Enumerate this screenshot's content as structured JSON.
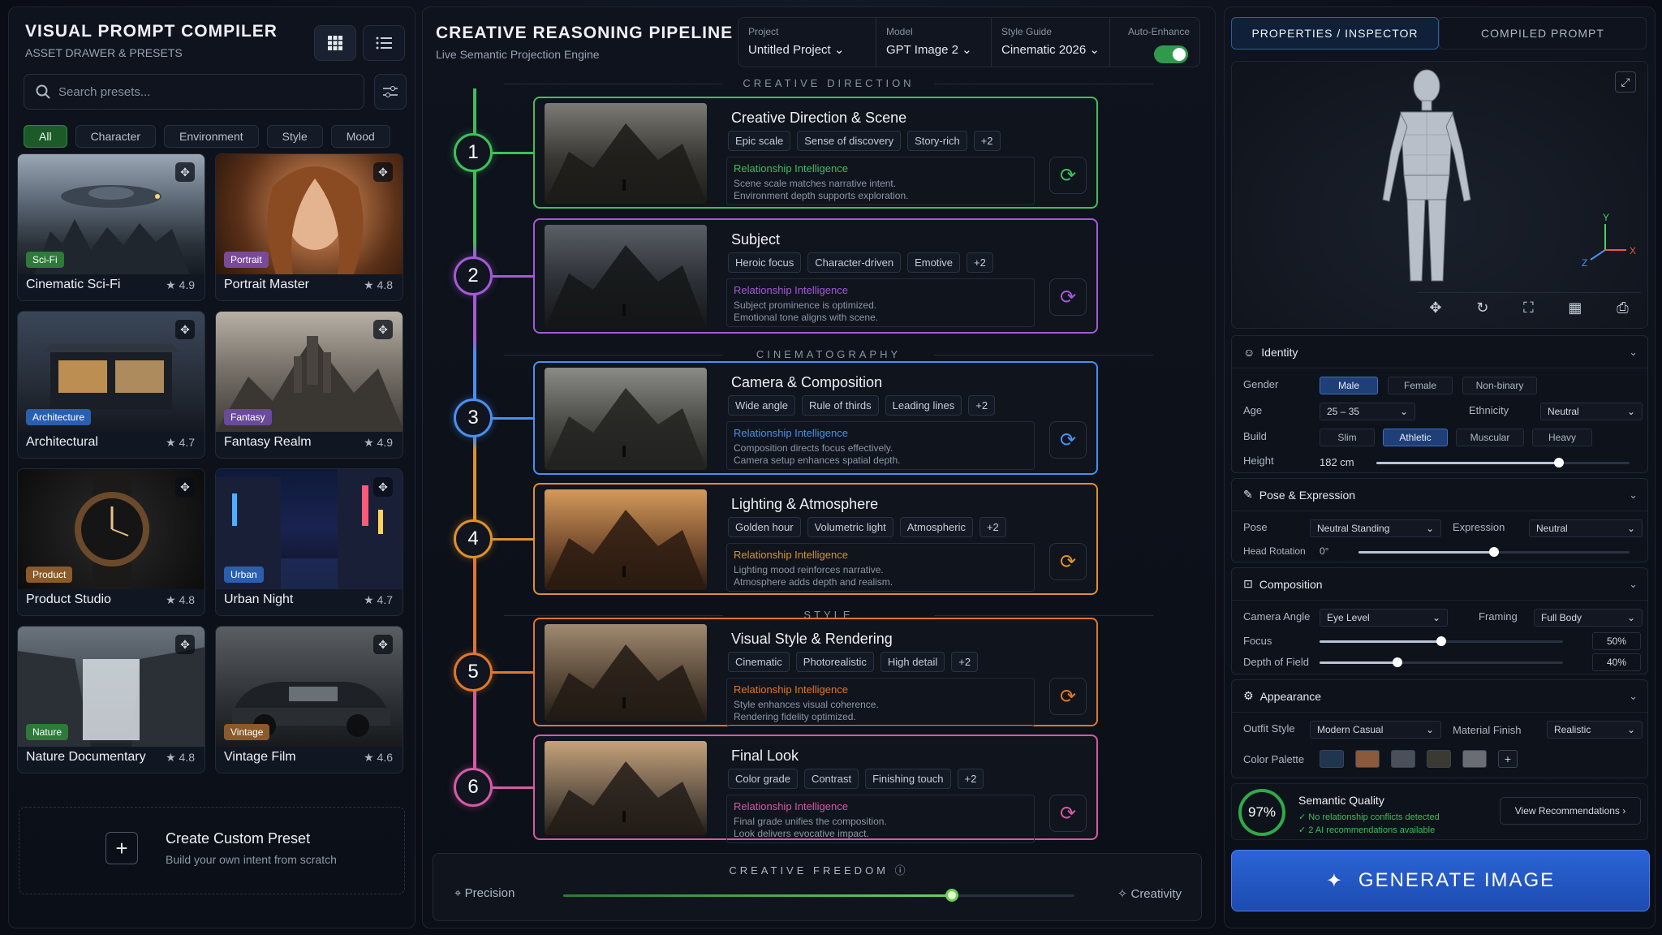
{
  "left": {
    "title": "VISUAL PROMPT COMPILER",
    "subtitle": "ASSET DRAWER & PRESETS",
    "search_placeholder": "Search presets...",
    "filters": [
      "All",
      "Character",
      "Environment",
      "Style",
      "Mood"
    ],
    "presets": [
      {
        "name": "Cinematic Sci-Fi",
        "tag": "Sci-Fi",
        "rating": "4.9",
        "tag_color": "#2d7a3a"
      },
      {
        "name": "Portrait Master",
        "tag": "Portrait",
        "rating": "4.8",
        "tag_color": "#7a4a9a"
      },
      {
        "name": "Architectural",
        "tag": "Architecture",
        "rating": "4.7",
        "tag_color": "#2a5fb0"
      },
      {
        "name": "Fantasy Realm",
        "tag": "Fantasy",
        "rating": "4.9",
        "tag_color": "#6a4a9a"
      },
      {
        "name": "Product Studio",
        "tag": "Product",
        "rating": "4.8",
        "tag_color": "#8a5a2a"
      },
      {
        "name": "Urban Night",
        "tag": "Urban",
        "rating": "4.7",
        "tag_color": "#2a5fb0"
      },
      {
        "name": "Nature Documentary",
        "tag": "Nature",
        "rating": "4.8",
        "tag_color": "#2d7a3a"
      },
      {
        "name": "Vintage Film",
        "tag": "Vintage",
        "rating": "4.6",
        "tag_color": "#8a5a2a"
      }
    ],
    "create_title": "Create Custom Preset",
    "create_sub": "Build your own intent from scratch"
  },
  "mid": {
    "title": "CREATIVE REASONING PIPELINE",
    "subtitle": "Live Semantic Projection Engine",
    "project_label": "Project",
    "project_value": "Untitled Project",
    "model_label": "Model",
    "model_value": "GPT Image 2",
    "style_label": "Style Guide",
    "style_value": "Cinematic 2026",
    "auto_label": "Auto-Enhance",
    "sections": [
      "CREATIVE DIRECTION",
      "CINEMATOGRAPHY",
      "STYLE"
    ],
    "steps": [
      {
        "num": "1",
        "title": "Creative Direction & Scene",
        "tags": [
          "Epic scale",
          "Sense of discovery",
          "Story-rich",
          "+2"
        ],
        "rel": "Relationship Intelligence",
        "l1": "Scene scale matches narrative intent.",
        "l2": "Environment depth supports exploration.",
        "color": "#3fbf5a"
      },
      {
        "num": "2",
        "title": "Subject",
        "tags": [
          "Heroic focus",
          "Character-driven",
          "Emotive",
          "+2"
        ],
        "rel": "Relationship Intelligence",
        "l1": "Subject prominence is optimized.",
        "l2": "Emotional tone aligns with scene.",
        "color": "#a45ad6"
      },
      {
        "num": "3",
        "title": "Camera & Composition",
        "tags": [
          "Wide angle",
          "Rule of thirds",
          "Leading lines",
          "+2"
        ],
        "rel": "Relationship Intelligence",
        "l1": "Composition directs focus effectively.",
        "l2": "Camera setup enhances spatial depth.",
        "color": "#4a8ff0"
      },
      {
        "num": "4",
        "title": "Lighting & Atmosphere",
        "tags": [
          "Golden hour",
          "Volumetric light",
          "Atmospheric",
          "+2"
        ],
        "rel": "Relationship Intelligence",
        "l1": "Lighting mood reinforces narrative.",
        "l2": "Atmosphere adds depth and realism.",
        "color": "#e0902a"
      },
      {
        "num": "5",
        "title": "Visual Style & Rendering",
        "tags": [
          "Cinematic",
          "Photorealistic",
          "High detail",
          "+2"
        ],
        "rel": "Relationship Intelligence",
        "l1": "Style enhances visual coherence.",
        "l2": "Rendering fidelity optimized.",
        "color": "#e0772a"
      },
      {
        "num": "6",
        "title": "Final Look",
        "tags": [
          "Color grade",
          "Contrast",
          "Finishing touch",
          "+2"
        ],
        "rel": "Relationship Intelligence",
        "l1": "Final grade unifies the composition.",
        "l2": "Look delivers evocative impact.",
        "color": "#d65aa6"
      }
    ],
    "freedom_title": "CREATIVE FREEDOM",
    "precision": "Precision",
    "creativity": "Creativity",
    "freedom_value": 0.76
  },
  "right": {
    "tab1": "PROPERTIES / INSPECTOR",
    "tab2": "COMPILED PROMPT",
    "identity": "Identity",
    "gender_l": "Gender",
    "genders": [
      "Male",
      "Female",
      "Non-binary"
    ],
    "age_l": "Age",
    "age_v": "25 – 35",
    "eth_l": "Ethnicity",
    "eth_v": "Neutral",
    "build_l": "Build",
    "builds": [
      "Slim",
      "Athletic",
      "Muscular",
      "Heavy"
    ],
    "height_l": "Height",
    "height_v": "182 cm",
    "height_value": 0.72,
    "pose_sec": "Pose & Expression",
    "pose_l": "Pose",
    "pose_v": "Neutral Standing",
    "expr_l": "Expression",
    "expr_v": "Neutral",
    "head_l": "Head Rotation",
    "head_v": "0°",
    "head_value": 0.5,
    "comp_sec": "Composition",
    "cam_l": "Camera Angle",
    "cam_v": "Eye Level",
    "frame_l": "Framing",
    "frame_v": "Full Body",
    "focus_l": "Focus",
    "focus_v": "50%",
    "focus_value": 0.5,
    "dof_l": "Depth of Field",
    "dof_v": "40%",
    "dof_value": 0.32,
    "app_sec": "Appearance",
    "outfit_l": "Outfit Style",
    "outfit_v": "Modern Casual",
    "mat_l": "Material Finish",
    "mat_v": "Realistic",
    "palette_l": "Color Palette",
    "palette": [
      "#1f3550",
      "#8a5a3a",
      "#4a505a",
      "#3a3a32",
      "#6a6e74"
    ],
    "quality_v": "97%",
    "quality_t": "Semantic Quality",
    "q1": "No relationship conflicts detected",
    "q2": "2 AI recommendations available",
    "view_rec": "View Recommendations",
    "generate": "GENERATE IMAGE",
    "axis_x": "X",
    "axis_y": "Y",
    "axis_z": "Z"
  }
}
